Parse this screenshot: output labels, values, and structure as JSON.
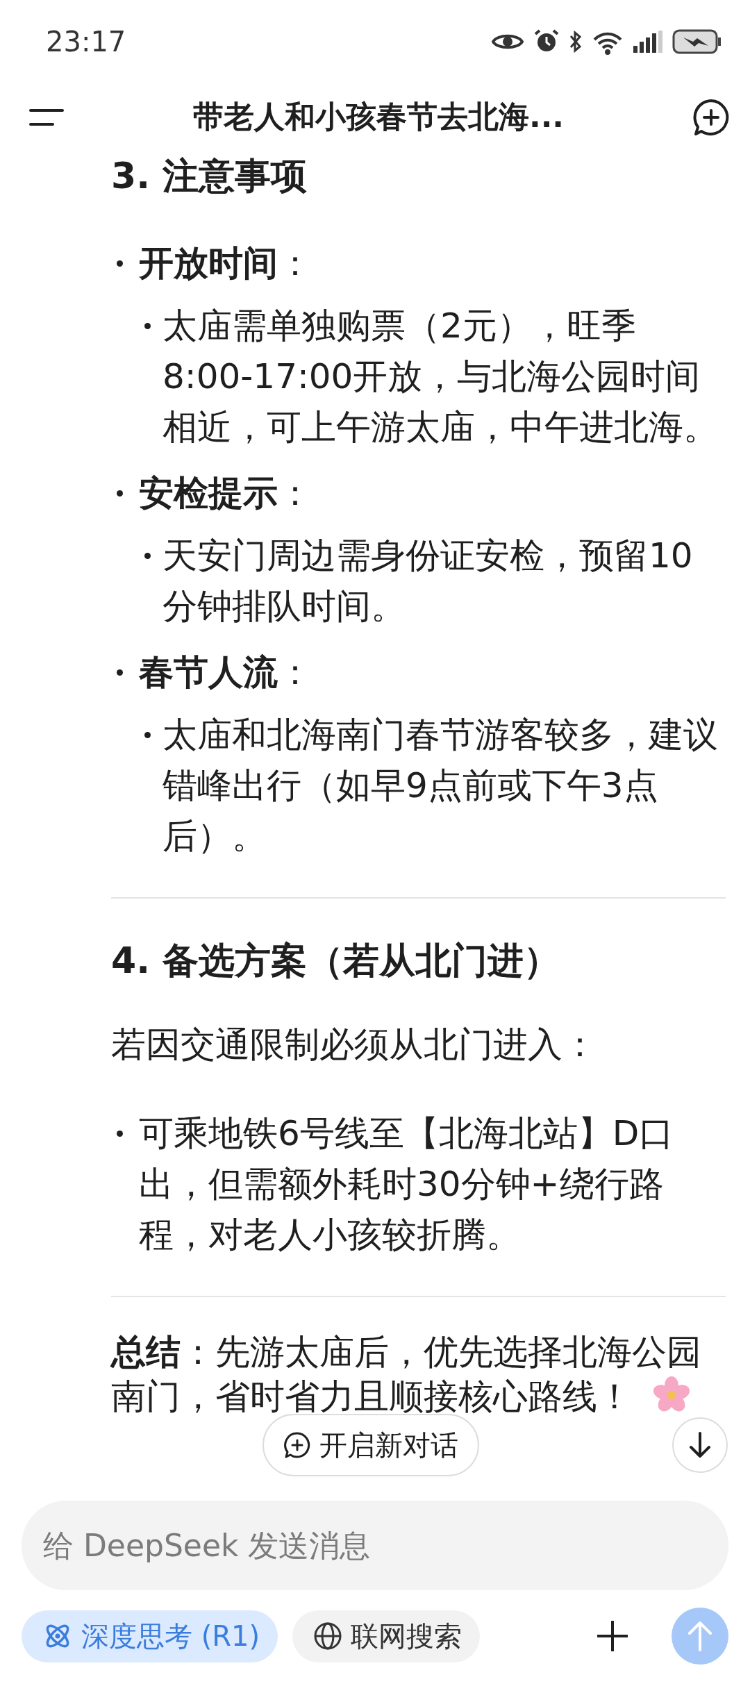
{
  "status_bar": {
    "time": "23:17"
  },
  "header": {
    "title": "带老人和小孩春节去北海..."
  },
  "content": [
    {
      "kind": "heading",
      "text": "3. 注意事项"
    },
    {
      "kind": "list",
      "items": [
        {
          "text": "**开放时间**：",
          "children": [
            {
              "text": "太庙需单独购票（2元），旺季8:00-17:00开放，与北海公园时间相近，可上午游太庙，中午进北海。"
            }
          ]
        },
        {
          "text": "**安检提示**：",
          "children": [
            {
              "text": "天安门周边需身份证安检，预留10分钟排队时间。"
            }
          ]
        },
        {
          "text": "**春节人流**：",
          "children": [
            {
              "text": "太庙和北海南门春节游客较多，建议错峰出行（如早9点前或下午3点后）。"
            }
          ]
        }
      ]
    },
    {
      "kind": "divider"
    },
    {
      "kind": "heading",
      "text": "4. 备选方案（若从北门进）"
    },
    {
      "kind": "paragraph",
      "text": "若因交通限制必须从北门进入："
    },
    {
      "kind": "list",
      "items": [
        {
          "text": "可乘地铁6号线至【北海北站】D口出，但需额外耗时30分钟+绕行路程，对老人小孩较折腾。"
        }
      ]
    },
    {
      "kind": "divider"
    },
    {
      "kind": "paragraph",
      "text": "**总结**：先游太庙后，优先选择北海公园南门，省时省力且顺接核心路线！",
      "flower": true
    }
  ],
  "new_chat_button": {
    "label": "开启新对话"
  },
  "composer": {
    "placeholder": "给 DeepSeek 发送消息",
    "chips": [
      {
        "kind": "deep-think",
        "label": "深度思考 (R1)",
        "selected": true
      },
      {
        "kind": "web-search",
        "label": "联网搜索",
        "selected": false
      }
    ],
    "send_enabled": false
  }
}
